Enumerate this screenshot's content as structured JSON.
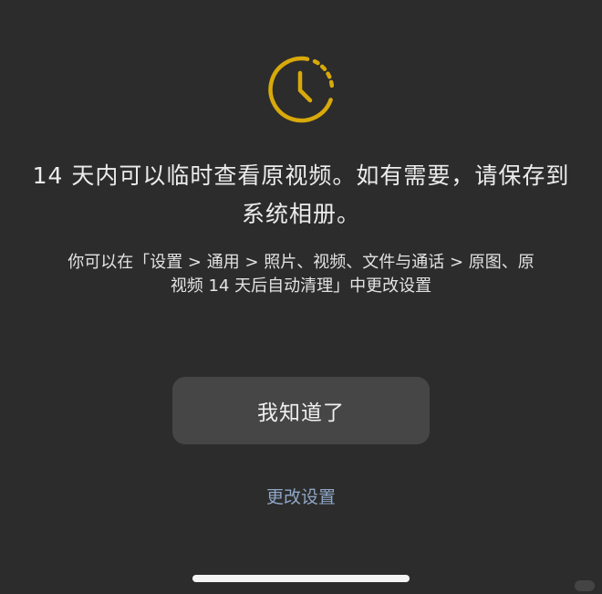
{
  "icon": {
    "name": "clock-icon",
    "color": "#d8a90a"
  },
  "dialog": {
    "headline_line1": "14 天内可以临时查看原视频。如有需要，请保存到",
    "headline_line2": "系统相册。",
    "subtext_line1": "你可以在「设置 > 通用 > 照片、视频、文件与通话 > 原图、原",
    "subtext_line2": "视频 14 天后自动清理」中更改设置",
    "ok_label": "我知道了",
    "settings_label": "更改设置"
  },
  "colors": {
    "background": "#2c2c2c",
    "button": "#464646",
    "link": "#8fa6c6",
    "accent": "#d8a90a"
  }
}
